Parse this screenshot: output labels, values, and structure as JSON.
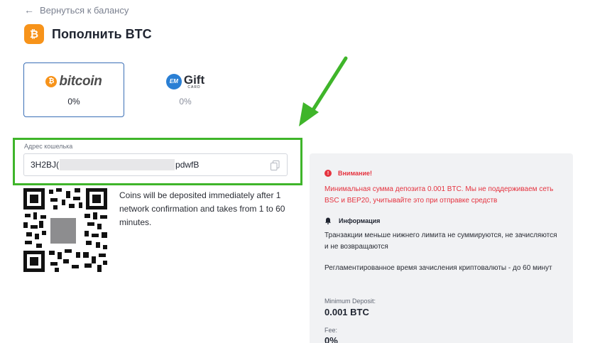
{
  "back_link": {
    "label": "Вернуться к балансу"
  },
  "header": {
    "title": "Пополнить BTC",
    "logo_glyph": "₿"
  },
  "methods": [
    {
      "brand": "bitcoin",
      "coin_glyph": "₿",
      "percent": "0%",
      "selected": true
    },
    {
      "brand_em": "EM",
      "brand_title": "Gift",
      "brand_sub": "CARD",
      "percent": "0%",
      "selected": false
    }
  ],
  "wallet": {
    "label": "Адрес кошелька",
    "address_start": "3H2BJ(",
    "address_end": "pdwfB",
    "copy_icon": "copy-icon"
  },
  "qr_note": "Coins will be deposited immediately after 1 network confirmation and takes from 1 to 60 minutes.",
  "panel": {
    "warning_title": "Внимание!",
    "warning_glyph": "!",
    "warning_text": "Минимальная сумма депозита 0.001 BTC. Мы не поддерживаем сеть BSC и BEP20, учитывайте это при отправке средств",
    "info_title": "Информация",
    "info_text_1": "Транзакции меньше нижнего лимита не суммируются, не зачисляются и не возвращаются",
    "info_text_2": "Регламентированное время зачисления криптовалюты - до 60 минут",
    "min_deposit_label": "Minimum Deposit:",
    "min_deposit_value": "0.001 BTC",
    "fee_label": "Fee:",
    "fee_value": "0%"
  },
  "colors": {
    "accent_green": "#3fb52a",
    "warning_red": "#e5333f",
    "btc_orange": "#f7931a",
    "selected_border": "#3b6fb6"
  }
}
